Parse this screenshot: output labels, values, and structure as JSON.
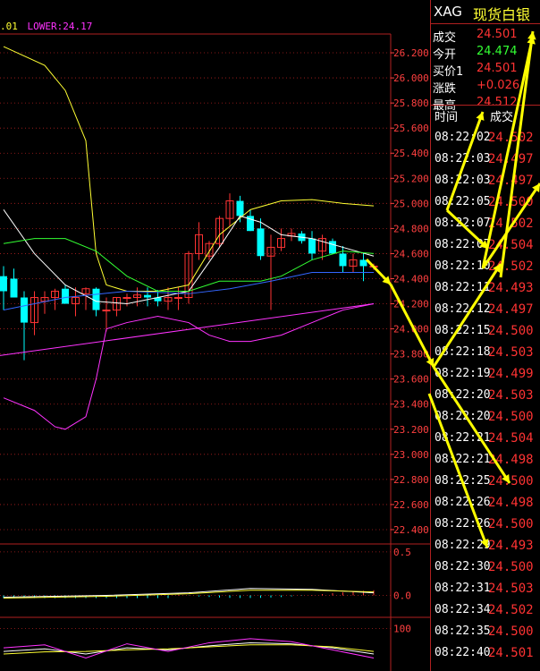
{
  "colors": {
    "up": "#ff3333",
    "down": "#00ffff",
    "grid": "#b02020",
    "axis": "#ff4040",
    "yellow": "#ffff33",
    "green": "#33ff33",
    "magenta": "#ff33ff",
    "white": "#ffffff",
    "bg": "#000000",
    "arrow": "#ffff00"
  },
  "legend": {
    "mid_fragment": ".01",
    "lower_label": "LOWER:24.17"
  },
  "quote": {
    "symbol": "XAG",
    "name": "现货白银",
    "rows": [
      {
        "label": "成交",
        "value": "24.501",
        "color": "#ff3333"
      },
      {
        "label": "今开",
        "value": "24.474",
        "color": "#33ff33"
      },
      {
        "label": "买价1",
        "value": "24.501",
        "color": "#ff3333"
      },
      {
        "label": "涨跌",
        "value": "+0.026",
        "color": "#ff3333"
      },
      {
        "label": "最高",
        "value": "24.512",
        "color": "#ff3333"
      }
    ]
  },
  "trades_header": {
    "time": "时间",
    "price": "成交"
  },
  "trades": [
    {
      "time": "08:22:02",
      "price": "24.502"
    },
    {
      "time": "08:22:03",
      "price": "24.497"
    },
    {
      "time": "08:22:03",
      "price": "24.497"
    },
    {
      "time": "08:22:05",
      "price": "24.500"
    },
    {
      "time": "08:22:07",
      "price": "24.502"
    },
    {
      "time": "08:22:07",
      "price": "24.504"
    },
    {
      "time": "08:22:10",
      "price": "24.502"
    },
    {
      "time": "08:22:11",
      "price": "24.493"
    },
    {
      "time": "08:22:12",
      "price": "24.497"
    },
    {
      "time": "08:22:15",
      "price": "24.500"
    },
    {
      "time": "08:22:18",
      "price": "24.503"
    },
    {
      "time": "08:22:19",
      "price": "24.499"
    },
    {
      "time": "08:22:20",
      "price": "24.503"
    },
    {
      "time": "08:22:20",
      "price": "24.500"
    },
    {
      "time": "08:22:21",
      "price": "24.504"
    },
    {
      "time": "08:22:21",
      "price": "24.498"
    },
    {
      "time": "08:22:25",
      "price": "24.500"
    },
    {
      "time": "08:22:26",
      "price": "24.498"
    },
    {
      "time": "08:22:26",
      "price": "24.500"
    },
    {
      "time": "08:22:29",
      "price": "24.493"
    },
    {
      "time": "08:22:30",
      "price": "24.500"
    },
    {
      "time": "08:22:31",
      "price": "24.503"
    },
    {
      "time": "08:22:34",
      "price": "24.502"
    },
    {
      "time": "08:22:35",
      "price": "24.500"
    },
    {
      "time": "08:22:40",
      "price": "24.501"
    }
  ],
  "chart_data": {
    "type": "candlestick",
    "main_axis": {
      "ylim": [
        22.3,
        26.35
      ],
      "ticks": [
        "26.200",
        "26.000",
        "25.800",
        "25.600",
        "25.400",
        "25.200",
        "25.000",
        "24.800",
        "24.600",
        "24.400",
        "24.200",
        "24.000",
        "23.800",
        "23.600",
        "23.400",
        "23.200",
        "23.000",
        "22.800",
        "22.600",
        "22.400"
      ]
    },
    "candles": [
      {
        "o": 24.42,
        "h": 24.5,
        "l": 24.15,
        "c": 24.3
      },
      {
        "o": 24.4,
        "h": 24.48,
        "l": 24.25,
        "c": 24.25
      },
      {
        "o": 24.25,
        "h": 24.3,
        "l": 23.75,
        "c": 24.05
      },
      {
        "o": 24.05,
        "h": 24.3,
        "l": 23.95,
        "c": 24.25
      },
      {
        "o": 24.22,
        "h": 24.3,
        "l": 24.12,
        "c": 24.25
      },
      {
        "o": 24.25,
        "h": 24.32,
        "l": 24.15,
        "c": 24.3
      },
      {
        "o": 24.32,
        "h": 24.35,
        "l": 24.2,
        "c": 24.2
      },
      {
        "o": 24.2,
        "h": 24.33,
        "l": 24.1,
        "c": 24.25
      },
      {
        "o": 24.28,
        "h": 24.33,
        "l": 24.15,
        "c": 24.32
      },
      {
        "o": 24.32,
        "h": 24.33,
        "l": 24.1,
        "c": 24.15
      },
      {
        "o": 24.15,
        "h": 24.25,
        "l": 23.98,
        "c": 24.15
      },
      {
        "o": 24.15,
        "h": 24.25,
        "l": 24.1,
        "c": 24.25
      },
      {
        "o": 24.25,
        "h": 24.28,
        "l": 24.18,
        "c": 24.25
      },
      {
        "o": 24.25,
        "h": 24.33,
        "l": 24.18,
        "c": 24.27
      },
      {
        "o": 24.27,
        "h": 24.33,
        "l": 24.18,
        "c": 24.25
      },
      {
        "o": 24.25,
        "h": 24.31,
        "l": 24.18,
        "c": 24.22
      },
      {
        "o": 24.22,
        "h": 24.33,
        "l": 24.15,
        "c": 24.25
      },
      {
        "o": 24.25,
        "h": 24.33,
        "l": 24.15,
        "c": 24.25
      },
      {
        "o": 24.25,
        "h": 24.62,
        "l": 24.2,
        "c": 24.6
      },
      {
        "o": 24.6,
        "h": 24.85,
        "l": 24.55,
        "c": 24.75
      },
      {
        "o": 24.58,
        "h": 24.7,
        "l": 24.55,
        "c": 24.68
      },
      {
        "o": 24.68,
        "h": 24.9,
        "l": 24.65,
        "c": 24.88
      },
      {
        "o": 24.88,
        "h": 25.08,
        "l": 24.82,
        "c": 25.02
      },
      {
        "o": 25.02,
        "h": 25.06,
        "l": 24.85,
        "c": 24.9
      },
      {
        "o": 24.9,
        "h": 24.95,
        "l": 24.78,
        "c": 24.78
      },
      {
        "o": 24.8,
        "h": 24.88,
        "l": 24.55,
        "c": 24.58
      },
      {
        "o": 24.58,
        "h": 24.75,
        "l": 24.15,
        "c": 24.65
      },
      {
        "o": 24.65,
        "h": 24.8,
        "l": 24.62,
        "c": 24.72
      },
      {
        "o": 24.74,
        "h": 24.8,
        "l": 24.7,
        "c": 24.76
      },
      {
        "o": 24.76,
        "h": 24.78,
        "l": 24.68,
        "c": 24.7
      },
      {
        "o": 24.72,
        "h": 24.78,
        "l": 24.55,
        "c": 24.6
      },
      {
        "o": 24.62,
        "h": 24.75,
        "l": 24.55,
        "c": 24.72
      },
      {
        "o": 24.7,
        "h": 24.72,
        "l": 24.6,
        "c": 24.6
      },
      {
        "o": 24.6,
        "h": 24.66,
        "l": 24.45,
        "c": 24.5
      },
      {
        "o": 24.5,
        "h": 24.6,
        "l": 24.45,
        "c": 24.55
      },
      {
        "o": 24.55,
        "h": 24.6,
        "l": 24.38,
        "c": 24.5
      },
      {
        "o": 24.5,
        "h": 24.52,
        "l": 24.47,
        "c": 24.5
      }
    ],
    "series_main": [
      {
        "name": "yellow-ma",
        "color": "#ffff33",
        "values": [
          [
            0,
            26.25
          ],
          [
            4,
            26.1
          ],
          [
            6,
            25.9
          ],
          [
            8,
            25.5
          ],
          [
            9,
            24.6
          ],
          [
            10,
            24.35
          ],
          [
            12,
            24.3
          ],
          [
            15,
            24.3
          ],
          [
            18,
            24.35
          ],
          [
            21,
            24.75
          ],
          [
            24,
            24.95
          ],
          [
            27,
            25.02
          ],
          [
            30,
            25.03
          ],
          [
            33,
            25.0
          ],
          [
            36,
            24.98
          ]
        ]
      },
      {
        "name": "white-ma",
        "color": "#ffffff",
        "values": [
          [
            0,
            24.95
          ],
          [
            3,
            24.6
          ],
          [
            6,
            24.35
          ],
          [
            9,
            24.22
          ],
          [
            12,
            24.2
          ],
          [
            15,
            24.25
          ],
          [
            18,
            24.3
          ],
          [
            21,
            24.65
          ],
          [
            23,
            24.9
          ],
          [
            25,
            24.85
          ],
          [
            27,
            24.75
          ],
          [
            30,
            24.72
          ],
          [
            33,
            24.65
          ],
          [
            36,
            24.58
          ]
        ]
      },
      {
        "name": "green-ma",
        "color": "#33ff33",
        "values": [
          [
            0,
            24.68
          ],
          [
            3,
            24.72
          ],
          [
            6,
            24.72
          ],
          [
            9,
            24.62
          ],
          [
            12,
            24.42
          ],
          [
            15,
            24.3
          ],
          [
            18,
            24.3
          ],
          [
            21,
            24.38
          ],
          [
            23,
            24.38
          ],
          [
            25,
            24.38
          ],
          [
            27,
            24.42
          ],
          [
            30,
            24.55
          ],
          [
            33,
            24.62
          ],
          [
            36,
            24.6
          ]
        ]
      },
      {
        "name": "blue-ma",
        "color": "#3366ff",
        "values": [
          [
            0,
            24.15
          ],
          [
            6,
            24.25
          ],
          [
            12,
            24.3
          ],
          [
            18,
            24.28
          ],
          [
            22,
            24.32
          ],
          [
            26,
            24.38
          ],
          [
            30,
            24.45
          ],
          [
            34,
            24.45
          ],
          [
            36,
            24.45
          ]
        ]
      },
      {
        "name": "magenta-band",
        "color": "#ff33ff",
        "values": [
          [
            0,
            23.45
          ],
          [
            3,
            23.35
          ],
          [
            5,
            23.22
          ],
          [
            6,
            23.2
          ],
          [
            8,
            23.3
          ],
          [
            9,
            23.6
          ],
          [
            10,
            24.0
          ],
          [
            12,
            24.05
          ],
          [
            15,
            24.1
          ],
          [
            18,
            24.05
          ],
          [
            20,
            23.95
          ],
          [
            22,
            23.9
          ],
          [
            24,
            23.9
          ],
          [
            27,
            23.95
          ],
          [
            30,
            24.05
          ],
          [
            33,
            24.15
          ],
          [
            36,
            24.2
          ]
        ]
      },
      {
        "name": "magenta-line",
        "color": "#ff33ff",
        "values": [
          [
            -1,
            23.78
          ],
          [
            36,
            24.2
          ]
        ]
      }
    ],
    "sub1": {
      "ylim": [
        -0.2,
        0.55
      ],
      "ticks": [
        "0.5",
        "0.0"
      ]
    },
    "sub2": {
      "ylim": [
        20,
        115
      ],
      "ticks": [
        "100"
      ]
    }
  }
}
